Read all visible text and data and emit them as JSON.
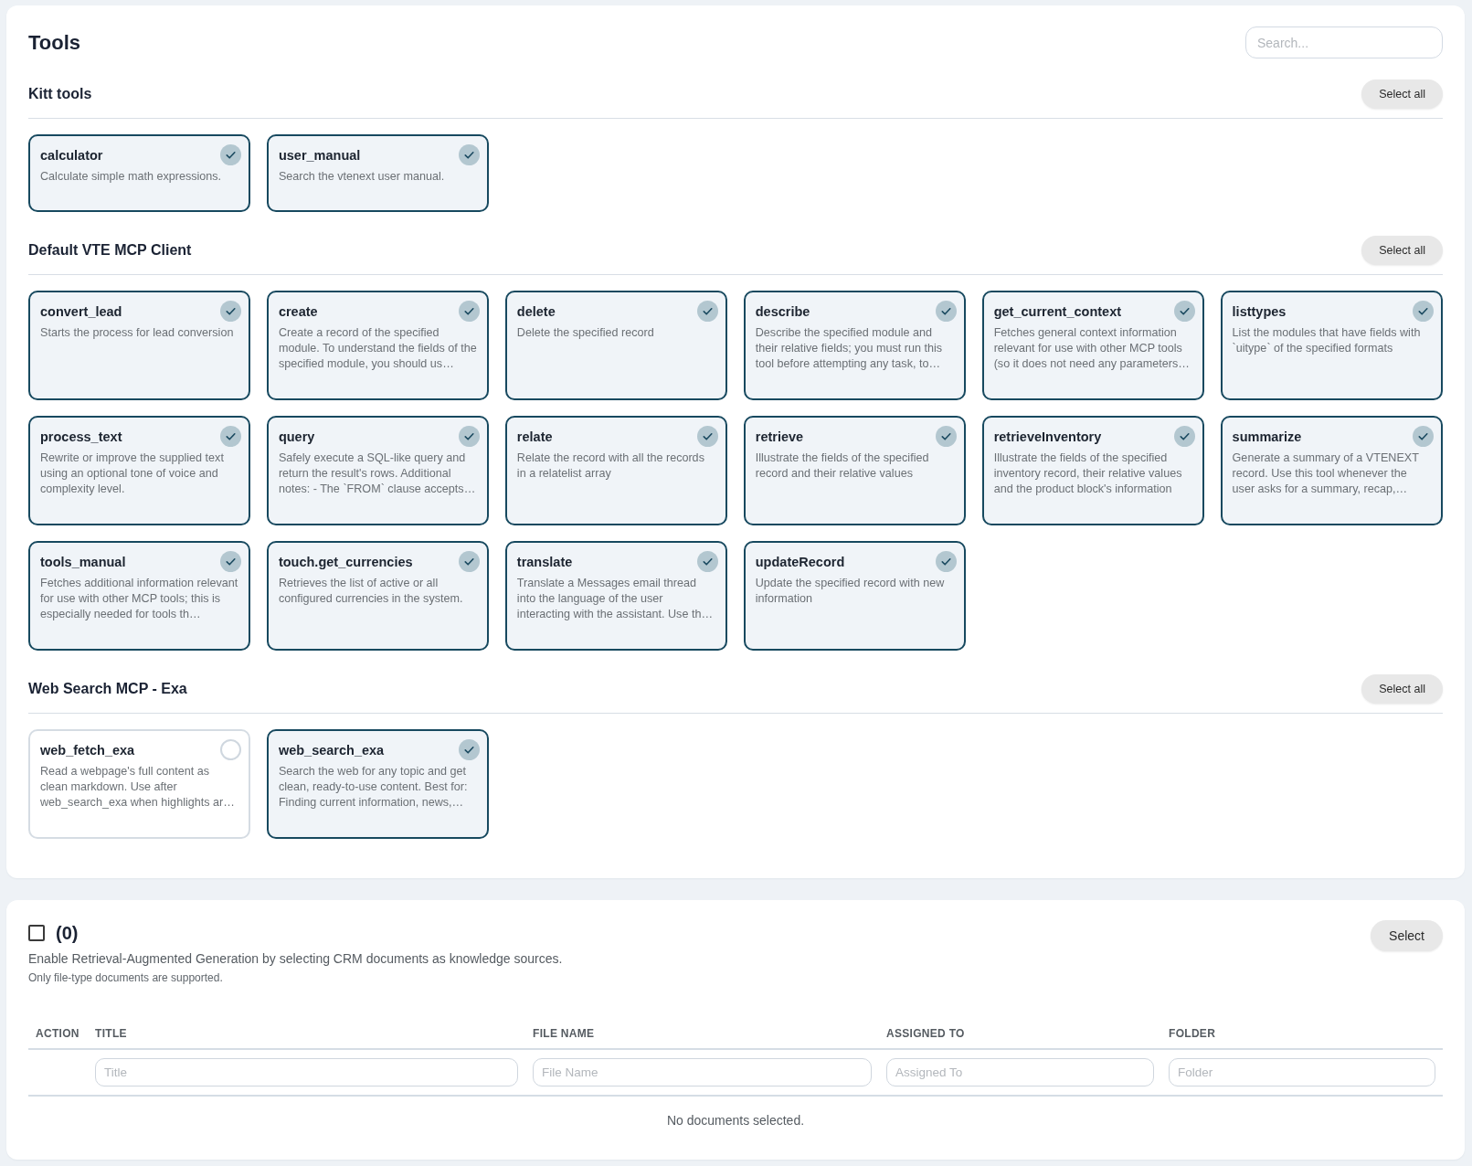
{
  "tools_panel": {
    "title": "Tools",
    "search": {
      "placeholder": "Search..."
    },
    "sections": [
      {
        "heading": "Kitt tools",
        "select_all": "Select all",
        "tools": [
          {
            "name": "calculator",
            "description": "Calculate simple math expressions.",
            "selected": true
          },
          {
            "name": "user_manual",
            "description": "Search the vtenext user manual.",
            "selected": true
          }
        ]
      },
      {
        "heading": "Default VTE MCP Client",
        "select_all": "Select all",
        "tools": [
          {
            "name": "convert_lead",
            "description": "Starts the process for lead conversion",
            "selected": true
          },
          {
            "name": "create",
            "description": "Create a record of the specified module. To understand the fields of the specified module, you should us…",
            "selected": true
          },
          {
            "name": "delete",
            "description": "Delete the specified record",
            "selected": true
          },
          {
            "name": "describe",
            "description": "Describe the specified module and their relative fields; you must run this tool before attempting any task, to…",
            "selected": true
          },
          {
            "name": "get_current_context",
            "description": "Fetches general context information relevant for use with other MCP tools (so it does not need any parameters…",
            "selected": true
          },
          {
            "name": "listtypes",
            "description": "List the modules that have fields with `uitype` of the specified formats",
            "selected": true
          },
          {
            "name": "process_text",
            "description": "Rewrite or improve the supplied text using an optional tone of voice and complexity level.",
            "selected": true
          },
          {
            "name": "query",
            "description": "Safely execute a SQL-like query and return the result's rows. Additional notes: - The `FROM` clause accepts…",
            "selected": true
          },
          {
            "name": "relate",
            "description": "Relate the record with all the records in a relatelist array",
            "selected": true
          },
          {
            "name": "retrieve",
            "description": "Illustrate the fields of the specified record and their relative values",
            "selected": true
          },
          {
            "name": "retrieveInventory",
            "description": "Illustrate the fields of the specified inventory record, their relative values and the product block's information",
            "selected": true
          },
          {
            "name": "summarize",
            "description": "Generate a summary of a VTENEXT record. Use this tool whenever the user asks for a summary, recap,…",
            "selected": true
          },
          {
            "name": "tools_manual",
            "description": "Fetches additional information relevant for use with other MCP tools; this is especially needed for tools th…",
            "selected": true
          },
          {
            "name": "touch.get_currencies",
            "description": "Retrieves the list of active or all configured currencies in the system.",
            "selected": true
          },
          {
            "name": "translate",
            "description": "Translate a Messages email thread into the language of the user interacting with the assistant. Use th…",
            "selected": true
          },
          {
            "name": "updateRecord",
            "description": "Update the specified record with new information",
            "selected": true
          }
        ]
      },
      {
        "heading": "Web Search MCP - Exa",
        "select_all": "Select all",
        "tools": [
          {
            "name": "web_fetch_exa",
            "description": "Read a webpage's full content as clean markdown. Use after web_search_exa when highlights ar…",
            "selected": false
          },
          {
            "name": "web_search_exa",
            "description": "Search the web for any topic and get clean, ready-to-use content. Best for: Finding current information, news,…",
            "selected": true
          }
        ]
      }
    ]
  },
  "documents_panel": {
    "checked": false,
    "count": "(0)",
    "description": "Enable Retrieval-Augmented Generation by selecting CRM documents as knowledge sources.",
    "note": "Only file-type documents are supported.",
    "select_button": "Select",
    "table": {
      "columns": [
        {
          "label": "ACTION"
        },
        {
          "label": "TITLE",
          "filter_placeholder": "Title"
        },
        {
          "label": "FILE NAME",
          "filter_placeholder": "File Name"
        },
        {
          "label": "ASSIGNED TO",
          "filter_placeholder": "Assigned To"
        },
        {
          "label": "FOLDER",
          "filter_placeholder": "Folder"
        }
      ],
      "empty_message": "No documents selected."
    }
  }
}
